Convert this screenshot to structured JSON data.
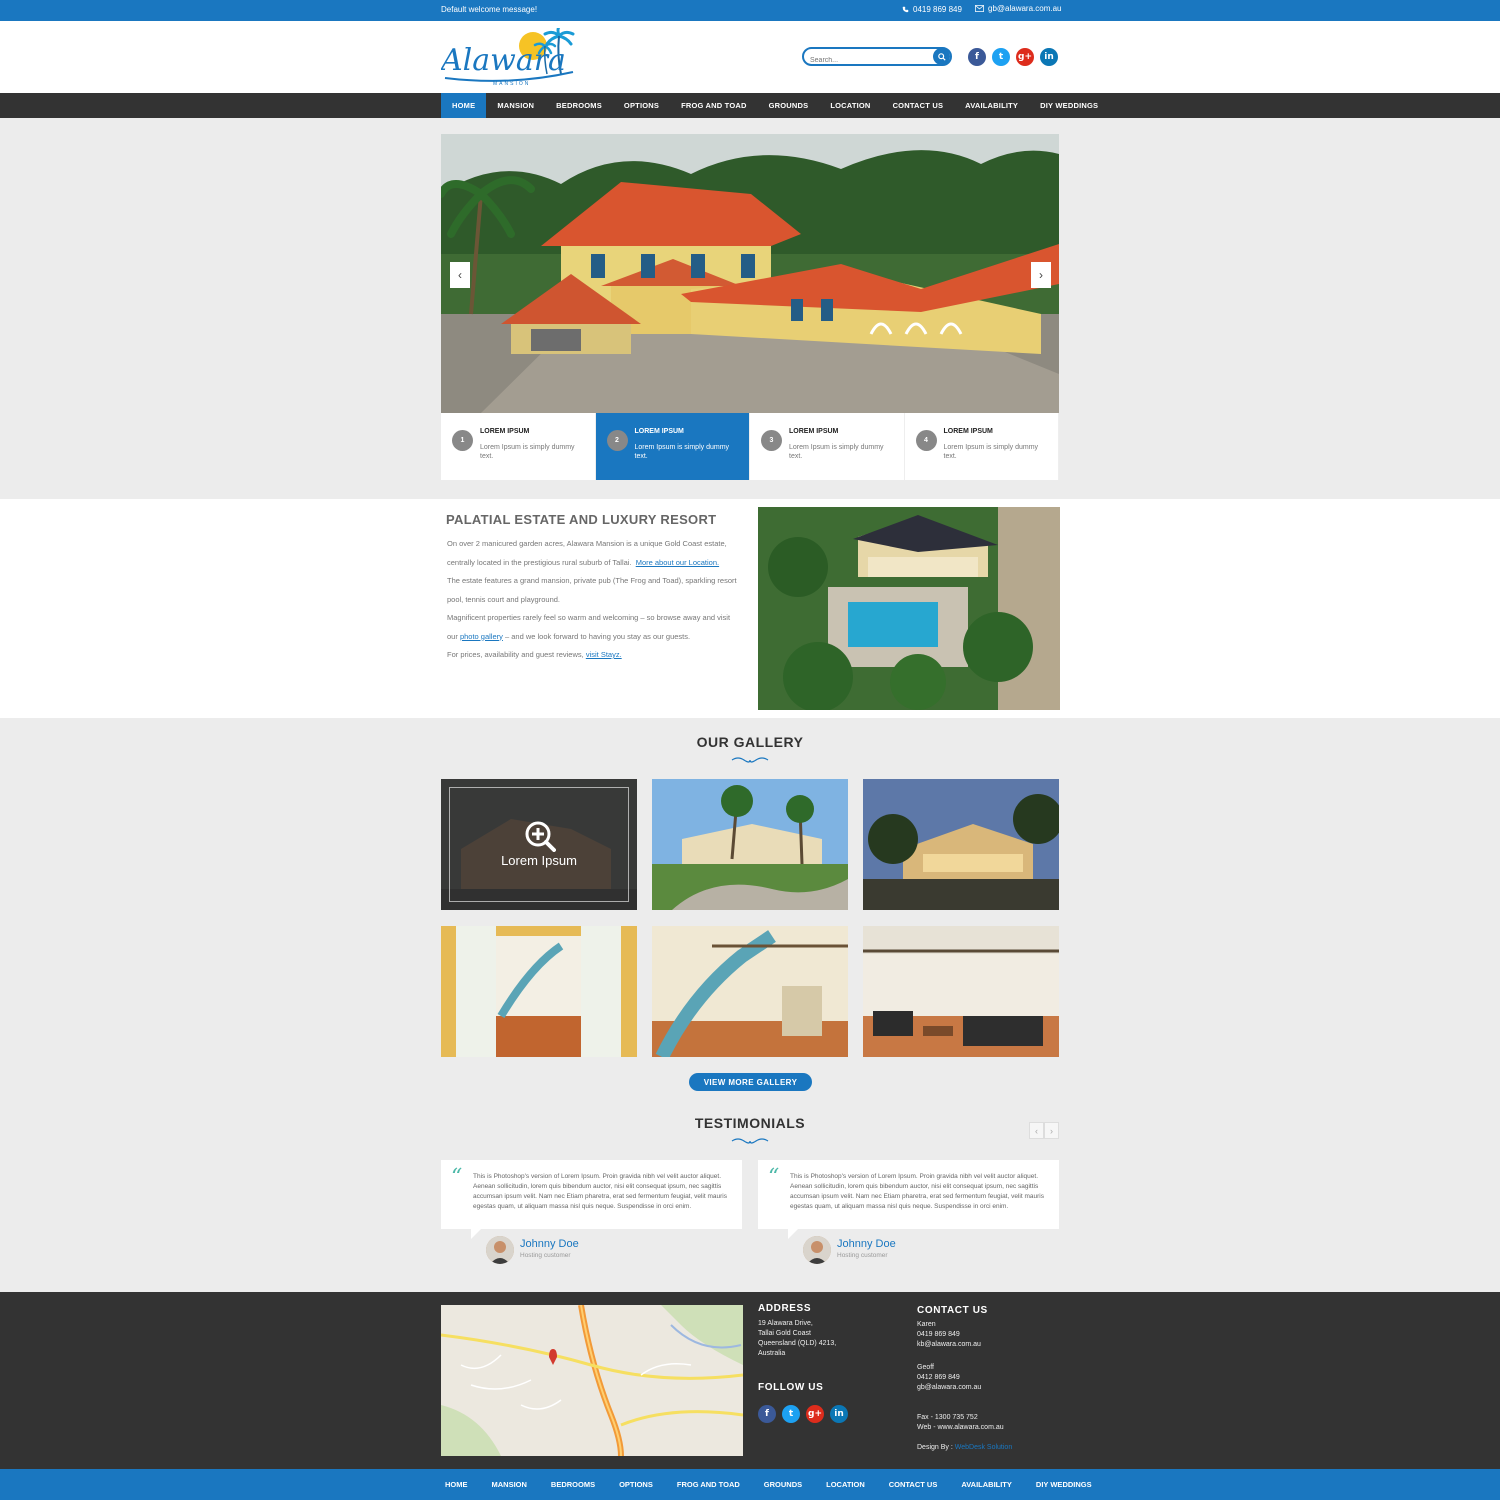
{
  "topbar": {
    "welcome": "Default welcome message!",
    "phone": "0419 869 849",
    "email": "gb@alawara.com.au"
  },
  "header": {
    "logo_text": "Alawara",
    "logo_sub": "MANSION",
    "search_placeholder": "Search...",
    "social": [
      "f",
      "t",
      "g+",
      "in"
    ]
  },
  "nav": [
    "HOME",
    "MANSION",
    "BEDROOMS",
    "OPTIONS",
    "FROG AND TOAD",
    "GROUNDS",
    "LOCATION",
    "CONTACT US",
    "AVAILABILITY",
    "DIY WEDDINGS"
  ],
  "slider": {
    "prev": "‹",
    "next": "›",
    "thumbs": [
      {
        "num": "1",
        "title": "LOREM IPSUM",
        "desc": "Lorem Ipsum is simply dummy text."
      },
      {
        "num": "2",
        "title": "LOREM IPSUM",
        "desc": "Lorem Ipsum is simply dummy text."
      },
      {
        "num": "3",
        "title": "LOREM IPSUM",
        "desc": "Lorem Ipsum is simply dummy text."
      },
      {
        "num": "4",
        "title": "LOREM IPSUM",
        "desc": "Lorem Ipsum is simply dummy text."
      }
    ]
  },
  "about": {
    "title": "PALATIAL ESTATE AND LUXURY RESORT",
    "p1": "On over 2 manicured garden acres, Alawara Mansion is a unique Gold Coast estate, centrally located in the prestigious rural suburb of Tallai.",
    "p1_link": "More about our Location.",
    "p2": "The estate features a grand mansion, private pub (The Frog and Toad), sparkling resort pool, tennis court and playground.",
    "p3a": "Magnificent properties rarely feel so warm and welcoming – so browse away and visit our",
    "p3_link": "photo gallery",
    "p3b": "– and we look forward to having you stay as our guests.",
    "p4": "For prices, availability and guest reviews,",
    "p4_link": "visit Stayz."
  },
  "gallery": {
    "title": "OUR GALLERY",
    "hover_caption": "Lorem Ipsum",
    "button": "VIEW MORE GALLERY"
  },
  "testimonials": {
    "title": "TESTIMONIALS",
    "prev": "‹",
    "next": "›",
    "items": [
      {
        "text": "This is Photoshop's version  of Lorem Ipsum. Proin gravida nibh vel velit auctor aliquet. Aenean sollicitudin, lorem quis bibendum auctor, nisi elit consequat ipsum, nec sagittis accumsan ipsum velit. Nam nec Etiam pharetra, erat sed fermentum feugiat, velit mauris egestas quam, ut aliquam massa nisl quis neque. Suspendisse in orci enim.",
        "name": "Johnny Doe",
        "role": "Hosting customer"
      },
      {
        "text": "This is Photoshop's version  of Lorem Ipsum. Proin gravida nibh vel velit auctor aliquet. Aenean sollicitudin, lorem quis bibendum auctor, nisi elit consequat ipsum, nec sagittis accumsan ipsum velit. Nam nec Etiam pharetra, erat sed fermentum feugiat, velit mauris egestas quam, ut aliquam massa nisl quis neque. Suspendisse in orci enim.",
        "name": "Johnny Doe",
        "role": "Hosting customer"
      }
    ]
  },
  "footer": {
    "address_title": "ADDRESS",
    "address": [
      "19 Alawara Drive,",
      "Tallai Gold Coast",
      "Queensland (QLD) 4213,",
      "Australia"
    ],
    "follow_title": "FOLLOW US",
    "contact_title": "CONTACT US",
    "contact1": [
      "Karen",
      "0419 869 849",
      "kb@alawara.com.au"
    ],
    "contact2": [
      "Geoff",
      "0412 869 849",
      "gb@alawara.com.au"
    ],
    "fax": "Fax - 1300 735 752",
    "web": "Web - www.alawara.com.au",
    "design_by": "Design By :",
    "designer": "WebDesk Solution"
  },
  "bottom_nav": [
    "HOME",
    "MANSION",
    "BEDROOMS",
    "OPTIONS",
    "FROG AND TOAD",
    "GROUNDS",
    "LOCATION",
    "CONTACT US",
    "AVAILABILITY",
    "DIY WEDDINGS"
  ],
  "colors": {
    "accent": "#1a77c0",
    "dark": "#333333",
    "quote": "#4cb8a8"
  }
}
